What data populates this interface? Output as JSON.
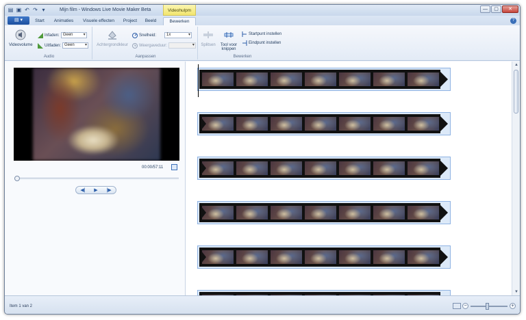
{
  "titlebar": {
    "title": "Mijn film - Windows Live Movie Maker Beta",
    "context_tab_group": "Videohulpm",
    "min": "—",
    "max": "▢",
    "close": "✕"
  },
  "tabs": [
    "Start",
    "Animaties",
    "Visuele effecten",
    "Project",
    "Beeld",
    "Bewerken"
  ],
  "active_tab": "Bewerken",
  "help": "?",
  "ribbon": {
    "audio": {
      "label": "Audio",
      "videovolume": "Videovolume",
      "fade_in_label": "Infaden:",
      "fade_in_value": "Geen",
      "fade_out_label": "Uitfaden:",
      "fade_out_value": "Geen"
    },
    "adjust": {
      "label": "Aanpassen",
      "background_color": "Achtergrondkleur",
      "speed_label": "Snelheid:",
      "speed_value": "1x",
      "duration_label": "Weergaveduur:",
      "duration_value": ""
    },
    "edit": {
      "label": "Bewerken",
      "split": "Splitsen",
      "trim_tool_line1": "Tool voor",
      "trim_tool_line2": "knippen",
      "set_start": "Startpunt instellen",
      "set_end": "Eindpunt instellen"
    }
  },
  "preview": {
    "timecode": "00:00/57:11"
  },
  "status": {
    "text": "Item 1 van 2"
  }
}
